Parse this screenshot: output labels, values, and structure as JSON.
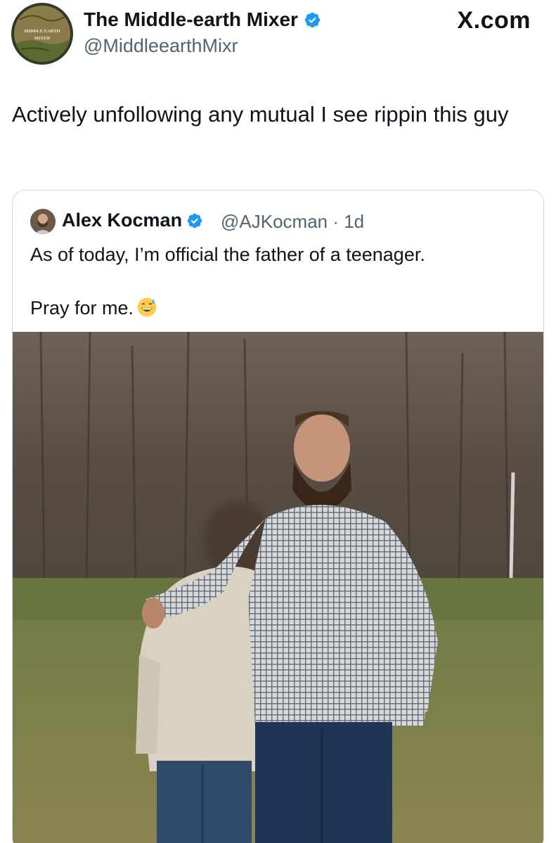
{
  "brand": "X.com",
  "author": {
    "name": "The Middle-earth Mixer",
    "handle": "@MiddleearthMixr",
    "verified": true,
    "avatar_text": "MIDDLE EARTH MIXER"
  },
  "tweet": {
    "text": "Actively unfollowing any mutual I see rippin this guy"
  },
  "quoted": {
    "name": "Alex Kocman",
    "handle": "@AJKocman",
    "time": "1d",
    "handle_time": "@AJKocman · 1d",
    "verified": true,
    "line1": "As of today, I’m official the father of a teenager.",
    "line2": "Pray for me.",
    "emoji": "grinning-face-with-sweat"
  },
  "colors": {
    "verified_blue": "#1d9bf0",
    "text": "#0f1419",
    "muted": "#536471",
    "border": "#cfd9de"
  }
}
